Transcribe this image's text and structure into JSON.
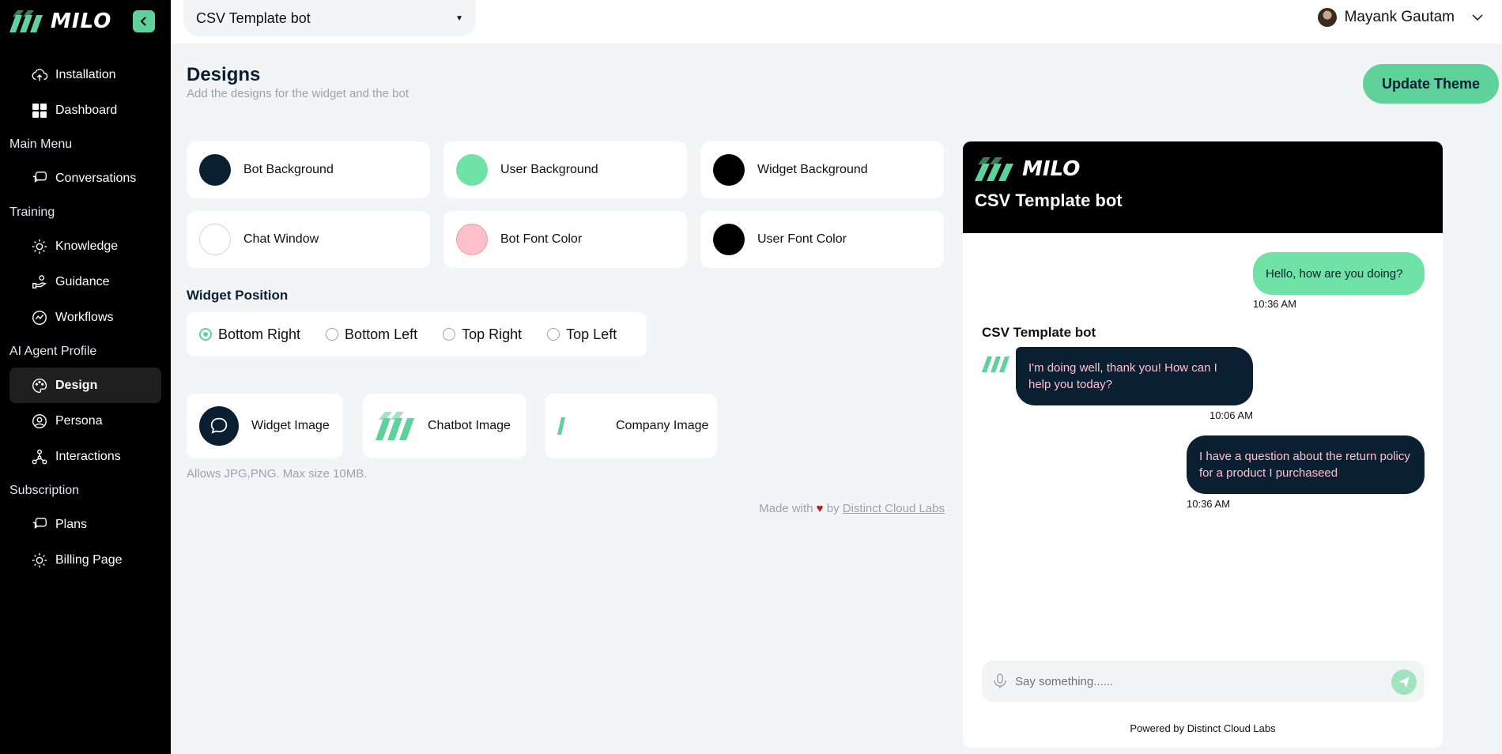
{
  "app": {
    "logo_text": "MILO"
  },
  "sidebar": {
    "items": [
      {
        "type": "item",
        "label": "Installation",
        "icon": "cloud-upload-icon"
      },
      {
        "type": "item",
        "label": "Dashboard",
        "icon": "grid-icon"
      },
      {
        "type": "section",
        "label": "Main Menu"
      },
      {
        "type": "item",
        "label": "Conversations",
        "icon": "chat-icon"
      },
      {
        "type": "section",
        "label": "Training"
      },
      {
        "type": "item",
        "label": "Knowledge",
        "icon": "bulb-icon"
      },
      {
        "type": "item",
        "label": "Guidance",
        "icon": "hand-icon"
      },
      {
        "type": "item",
        "label": "Workflows",
        "icon": "workflow-icon"
      },
      {
        "type": "section",
        "label": "AI Agent Profile"
      },
      {
        "type": "item",
        "label": "Design",
        "icon": "palette-icon",
        "active": true
      },
      {
        "type": "item",
        "label": "Persona",
        "icon": "user-circle-icon"
      },
      {
        "type": "item",
        "label": "Interactions",
        "icon": "nodes-icon"
      },
      {
        "type": "section",
        "label": "Subscription"
      },
      {
        "type": "item",
        "label": "Plans",
        "icon": "chat-icon"
      },
      {
        "type": "item",
        "label": "Billing Page",
        "icon": "bulb-icon"
      }
    ]
  },
  "topbar": {
    "bot_select": "CSV Template bot",
    "user_name": "Mayank Gautam"
  },
  "main": {
    "title": "Designs",
    "subtitle": "Add the designs for the widget and the bot",
    "update_button": "Update Theme",
    "colors": [
      {
        "label": "Bot Background",
        "color": "#0b1f33"
      },
      {
        "label": "User Background",
        "color": "#6ee3a5"
      },
      {
        "label": "Widget Background",
        "color": "#000000"
      },
      {
        "label": "Chat Window",
        "color": "#ffffff"
      },
      {
        "label": "Bot Font Color",
        "color": "#ffc0cb"
      },
      {
        "label": "User Font Color",
        "color": "#000000"
      }
    ],
    "widget_position_label": "Widget Position",
    "positions": [
      {
        "label": "Bottom Right",
        "selected": true
      },
      {
        "label": "Bottom Left",
        "selected": false
      },
      {
        "label": "Top Right",
        "selected": false
      },
      {
        "label": "Top Left",
        "selected": false
      }
    ],
    "images": [
      {
        "label": "Widget Image",
        "icon": "chat-bubble-icon"
      },
      {
        "label": "Chatbot Image",
        "icon": "milo-mark-icon"
      },
      {
        "label": "Company Image",
        "icon": "company-logo-icon"
      }
    ],
    "allows_text": "Allows JPG,PNG. Max size 10MB.",
    "made_with_prefix": "Made with",
    "made_with_by": "by",
    "made_with_link": "Distinct Cloud Labs"
  },
  "preview": {
    "logo_text": "MILO",
    "bot_title": "CSV Template bot",
    "messages": [
      {
        "from": "user",
        "text": "Hello, how are you doing?",
        "time": "10:36 AM"
      },
      {
        "from": "bot",
        "text": "I'm doing well, thank you! How can I help you today?",
        "time": "10:06 AM"
      },
      {
        "from": "user",
        "text": "I have a question about the return policy for a product I purchaseed",
        "time": "10:36 AM"
      }
    ],
    "bot_name": "CSV Template bot",
    "input_placeholder": "Say something......",
    "powered_by": "Powered by Distinct Cloud Labs"
  },
  "colors": {
    "accent": "#5ed29a",
    "navy": "#0b1f33"
  }
}
